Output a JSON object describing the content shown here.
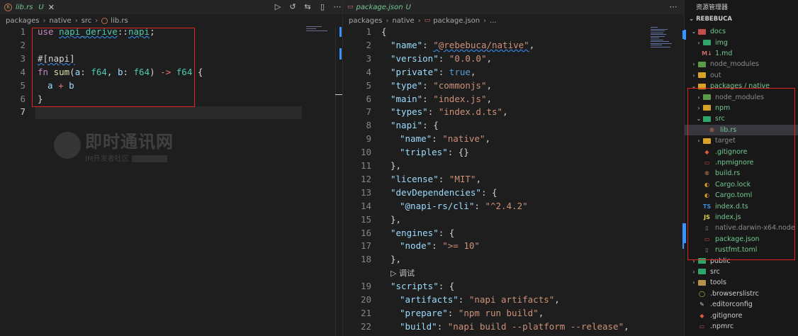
{
  "left_editor": {
    "tab": {
      "name": "lib.rs",
      "status": "U",
      "close": "✕"
    },
    "actions": [
      "▷",
      "↺",
      "⇆",
      "▯",
      "⋯"
    ],
    "breadcrumb": [
      "packages",
      "native",
      "src",
      "lib.rs"
    ],
    "current_line": 7,
    "lines": [
      {
        "n": "1"
      },
      {
        "n": "2"
      },
      {
        "n": "3"
      },
      {
        "n": "4"
      },
      {
        "n": "5"
      },
      {
        "n": "6"
      },
      {
        "n": "7"
      }
    ],
    "code": {
      "use_kw": "use",
      "crate": "napi_derive",
      "sep": "::",
      "item": "napi",
      "semi": ";",
      "attr": "#[napi]",
      "fn_kw": "fn",
      "fn_name": "sum",
      "p1": "a",
      "p1_ty": "f64",
      "p2": "b",
      "p2_ty": "f64",
      "ret": "->",
      "ret_ty": "f64",
      "open": "{",
      "body_a": "a",
      "plus": "+",
      "body_b": "b",
      "close": "}"
    },
    "watermark": {
      "title": "即时通讯网",
      "subtitle": "IM开发者社区"
    }
  },
  "right_editor": {
    "tab": {
      "name": "package.json",
      "status": "U"
    },
    "actions": [
      "⋯"
    ],
    "breadcrumb": [
      "packages",
      "native",
      "package.json",
      "..."
    ],
    "line_numbers": [
      "1",
      "2",
      "3",
      "4",
      "5",
      "6",
      "7",
      "8",
      "9",
      "10",
      "11",
      "12",
      "13",
      "14",
      "15",
      "16",
      "17",
      "18",
      "",
      "19",
      "20",
      "21",
      "22"
    ],
    "json_lines": [
      {
        "indent": 0,
        "parts": [
          {
            "t": "p",
            "v": "{"
          }
        ]
      },
      {
        "indent": 1,
        "parts": [
          {
            "t": "k",
            "v": "\"name\""
          },
          {
            "t": "p",
            "v": ": "
          },
          {
            "t": "s",
            "v": "\"@rebebuca/native\""
          },
          {
            "t": "p",
            "v": ","
          }
        ]
      },
      {
        "indent": 1,
        "parts": [
          {
            "t": "k",
            "v": "\"version\""
          },
          {
            "t": "p",
            "v": ": "
          },
          {
            "t": "s",
            "v": "\"0.0.0\""
          },
          {
            "t": "p",
            "v": ","
          }
        ]
      },
      {
        "indent": 1,
        "parts": [
          {
            "t": "k",
            "v": "\"private\""
          },
          {
            "t": "p",
            "v": ": "
          },
          {
            "t": "b",
            "v": "true"
          },
          {
            "t": "p",
            "v": ","
          }
        ]
      },
      {
        "indent": 1,
        "parts": [
          {
            "t": "k",
            "v": "\"type\""
          },
          {
            "t": "p",
            "v": ": "
          },
          {
            "t": "s",
            "v": "\"commonjs\""
          },
          {
            "t": "p",
            "v": ","
          }
        ]
      },
      {
        "indent": 1,
        "parts": [
          {
            "t": "k",
            "v": "\"main\""
          },
          {
            "t": "p",
            "v": ": "
          },
          {
            "t": "s",
            "v": "\"index.js\""
          },
          {
            "t": "p",
            "v": ","
          }
        ]
      },
      {
        "indent": 1,
        "parts": [
          {
            "t": "k",
            "v": "\"types\""
          },
          {
            "t": "p",
            "v": ": "
          },
          {
            "t": "s",
            "v": "\"index.d.ts\""
          },
          {
            "t": "p",
            "v": ","
          }
        ]
      },
      {
        "indent": 1,
        "parts": [
          {
            "t": "k",
            "v": "\"napi\""
          },
          {
            "t": "p",
            "v": ": {"
          }
        ]
      },
      {
        "indent": 2,
        "parts": [
          {
            "t": "k",
            "v": "\"name\""
          },
          {
            "t": "p",
            "v": ": "
          },
          {
            "t": "s",
            "v": "\"native\""
          },
          {
            "t": "p",
            "v": ","
          }
        ]
      },
      {
        "indent": 2,
        "parts": [
          {
            "t": "k",
            "v": "\"triples\""
          },
          {
            "t": "p",
            "v": ": {}"
          }
        ]
      },
      {
        "indent": 1,
        "parts": [
          {
            "t": "p",
            "v": "},"
          }
        ]
      },
      {
        "indent": 1,
        "parts": [
          {
            "t": "k",
            "v": "\"license\""
          },
          {
            "t": "p",
            "v": ": "
          },
          {
            "t": "s",
            "v": "\"MIT\""
          },
          {
            "t": "p",
            "v": ","
          }
        ]
      },
      {
        "indent": 1,
        "parts": [
          {
            "t": "k",
            "v": "\"devDependencies\""
          },
          {
            "t": "p",
            "v": ": {"
          }
        ]
      },
      {
        "indent": 2,
        "parts": [
          {
            "t": "k",
            "v": "\"@napi-rs/cli\""
          },
          {
            "t": "p",
            "v": ": "
          },
          {
            "t": "s",
            "v": "\"^2.4.2\""
          }
        ]
      },
      {
        "indent": 1,
        "parts": [
          {
            "t": "p",
            "v": "},"
          }
        ]
      },
      {
        "indent": 1,
        "parts": [
          {
            "t": "k",
            "v": "\"engines\""
          },
          {
            "t": "p",
            "v": ": {"
          }
        ]
      },
      {
        "indent": 2,
        "parts": [
          {
            "t": "k",
            "v": "\"node\""
          },
          {
            "t": "p",
            "v": ": "
          },
          {
            "t": "s",
            "v": "\">= 10\""
          }
        ]
      },
      {
        "indent": 1,
        "parts": [
          {
            "t": "p",
            "v": "},"
          }
        ]
      },
      {
        "indent": 1,
        "parts": [
          {
            "t": "f",
            "v": "▷ 调试"
          }
        ]
      },
      {
        "indent": 1,
        "parts": [
          {
            "t": "k",
            "v": "\"scripts\""
          },
          {
            "t": "p",
            "v": ": {"
          }
        ]
      },
      {
        "indent": 2,
        "parts": [
          {
            "t": "k",
            "v": "\"artifacts\""
          },
          {
            "t": "p",
            "v": ": "
          },
          {
            "t": "s",
            "v": "\"napi artifacts\""
          },
          {
            "t": "p",
            "v": ","
          }
        ]
      },
      {
        "indent": 2,
        "parts": [
          {
            "t": "k",
            "v": "\"prepare\""
          },
          {
            "t": "p",
            "v": ": "
          },
          {
            "t": "s",
            "v": "\"npm run build\""
          },
          {
            "t": "p",
            "v": ","
          }
        ]
      },
      {
        "indent": 2,
        "parts": [
          {
            "t": "k",
            "v": "\"build\""
          },
          {
            "t": "p",
            "v": ": "
          },
          {
            "t": "s",
            "v": "\"napi build --platform --release\""
          },
          {
            "t": "p",
            "v": ","
          }
        ]
      }
    ]
  },
  "explorer": {
    "title": "资源管理器",
    "root": "REBEBUCA",
    "rows": [
      {
        "depth": 1,
        "chev": "⌄",
        "icon": "folder",
        "color": "#c44d4d",
        "label": "docs",
        "style": "green"
      },
      {
        "depth": 2,
        "chev": "›",
        "icon": "folder",
        "color": "#2fa46b",
        "label": "img",
        "style": "green"
      },
      {
        "depth": 2,
        "chev": "",
        "icon": "md",
        "color": "#d16a6a",
        "label": "1.md",
        "style": "green"
      },
      {
        "depth": 1,
        "chev": "›",
        "icon": "folder",
        "color": "#5a9a4a",
        "label": "node_modules",
        "style": "grey"
      },
      {
        "depth": 1,
        "chev": "›",
        "icon": "folder",
        "color": "#d8a22a",
        "label": "out",
        "style": "grey"
      },
      {
        "depth": 1,
        "chev": "⌄",
        "icon": "folder",
        "color": "#d8a22a",
        "label": "packages / native",
        "style": "green"
      },
      {
        "depth": 2,
        "chev": "›",
        "icon": "folder",
        "color": "#5a9a4a",
        "label": "node_modules",
        "style": "grey"
      },
      {
        "depth": 2,
        "chev": "›",
        "icon": "folder",
        "color": "#d8a22a",
        "label": "npm",
        "style": "green"
      },
      {
        "depth": 2,
        "chev": "⌄",
        "icon": "folder",
        "color": "#2fa46b",
        "label": "src",
        "style": "green"
      },
      {
        "depth": 3,
        "chev": "",
        "icon": "rs",
        "color": "#b8714a",
        "label": "lib.rs",
        "style": "green",
        "selected": true
      },
      {
        "depth": 2,
        "chev": "›",
        "icon": "folder",
        "color": "#d8a22a",
        "label": "target",
        "style": "grey"
      },
      {
        "depth": 2,
        "chev": "",
        "icon": "git",
        "color": "#e05a3a",
        "label": ".gitignore",
        "style": "green"
      },
      {
        "depth": 2,
        "chev": "",
        "icon": "npm",
        "color": "#c44d4d",
        "label": ".npmignore",
        "style": "green"
      },
      {
        "depth": 2,
        "chev": "",
        "icon": "rs",
        "color": "#b8714a",
        "label": "build.rs",
        "style": "green"
      },
      {
        "depth": 2,
        "chev": "",
        "icon": "lock",
        "color": "#d8a22a",
        "label": "Cargo.lock",
        "style": "green"
      },
      {
        "depth": 2,
        "chev": "",
        "icon": "toml",
        "color": "#d8a22a",
        "label": "Cargo.toml",
        "style": "green"
      },
      {
        "depth": 2,
        "chev": "",
        "icon": "ts",
        "color": "#3d8fd1",
        "label": "index.d.ts",
        "style": "green"
      },
      {
        "depth": 2,
        "chev": "",
        "icon": "js",
        "color": "#e8d44d",
        "label": "index.js",
        "style": "green"
      },
      {
        "depth": 2,
        "chev": "",
        "icon": "file",
        "color": "#8b8b8b",
        "label": "native.darwin-x64.node",
        "style": "grey"
      },
      {
        "depth": 2,
        "chev": "",
        "icon": "npm",
        "color": "#c44d4d",
        "label": "package.json",
        "style": "green"
      },
      {
        "depth": 2,
        "chev": "",
        "icon": "file",
        "color": "#8b8b8b",
        "label": "rustfmt.toml",
        "style": "green"
      },
      {
        "depth": 1,
        "chev": "›",
        "icon": "folder",
        "color": "#2fa46b",
        "label": "public",
        "style": "white"
      },
      {
        "depth": 1,
        "chev": "›",
        "icon": "folder",
        "color": "#2fa46b",
        "label": "src",
        "style": "white"
      },
      {
        "depth": 1,
        "chev": "›",
        "icon": "folder",
        "color": "#b8914a",
        "label": "tools",
        "style": "white"
      },
      {
        "depth": 1,
        "chev": "",
        "icon": "browsers",
        "color": "#e8c84d",
        "label": ".browserslistrc",
        "style": "white"
      },
      {
        "depth": 1,
        "chev": "",
        "icon": "editorconfig",
        "color": "#cccccc",
        "label": ".editorconfig",
        "style": "white"
      },
      {
        "depth": 1,
        "chev": "",
        "icon": "git",
        "color": "#e05a3a",
        "label": ".gitignore",
        "style": "white"
      },
      {
        "depth": 1,
        "chev": "",
        "icon": "npm",
        "color": "#c44d4d",
        "label": ".npmrc",
        "style": "white"
      }
    ]
  }
}
